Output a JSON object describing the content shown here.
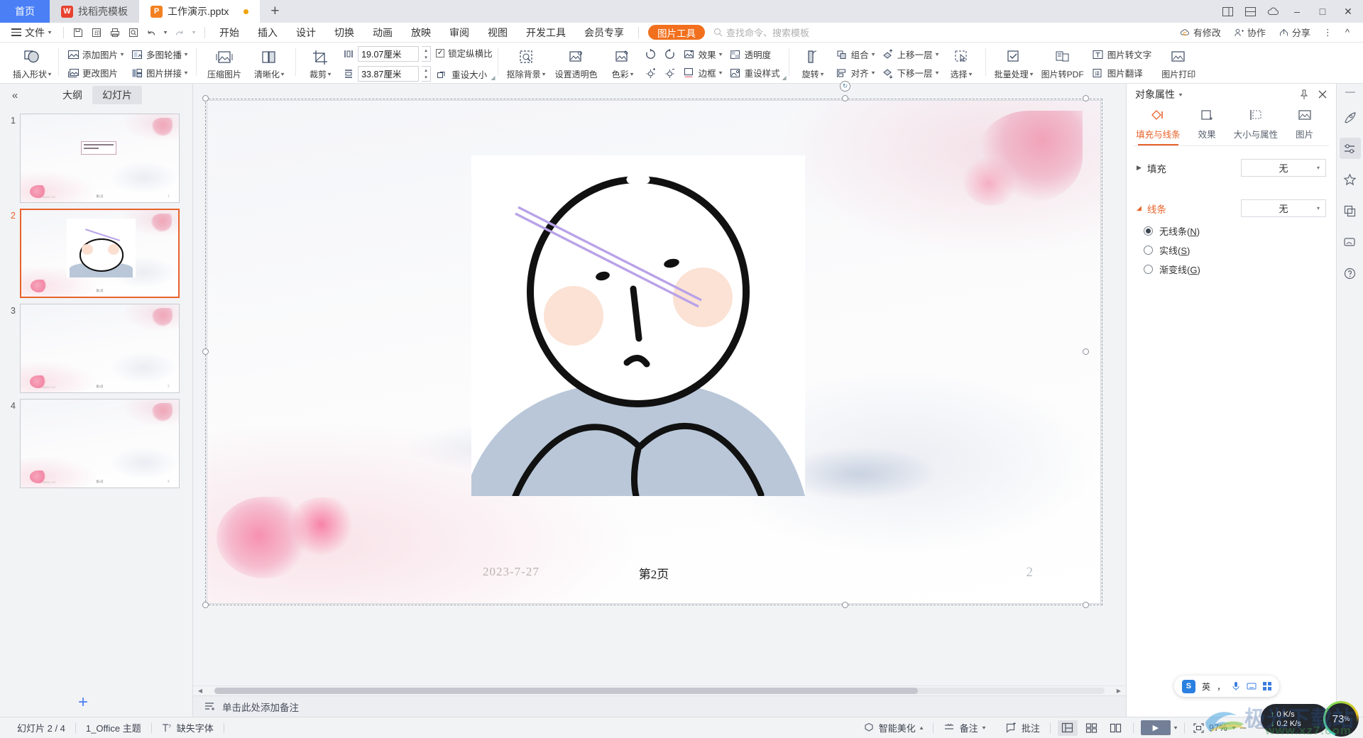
{
  "titlebar": {
    "home_tab": "首页",
    "tabs": [
      {
        "label": "找稻壳模板",
        "icon": "wps-template-icon",
        "active": false,
        "icon_color": "#e8422f",
        "icon_char": "W"
      },
      {
        "label": "工作演示.pptx",
        "icon": "presentation-icon",
        "active": true,
        "icon_color": "#f28121",
        "icon_char": "P"
      }
    ],
    "new_tab": "+",
    "right_icons": [
      "layout-icon",
      "split-icon",
      "cloud-icon"
    ],
    "window_buttons": [
      "–",
      "□",
      "✕"
    ]
  },
  "menubar": {
    "file": "文件",
    "quick_icons": [
      "save-icon",
      "print-preview-icon",
      "print-icon",
      "find-icon",
      "undo-icon",
      "redo-icon",
      "customize-icon"
    ],
    "items": [
      "开始",
      "插入",
      "设计",
      "切换",
      "动画",
      "放映",
      "审阅",
      "视图",
      "开发工具",
      "会员专享"
    ],
    "active_pill": "图片工具",
    "search_placeholder": "查找命令、搜索模板",
    "right": [
      {
        "label": "有修改",
        "icon": "cloud-sync-icon"
      },
      {
        "label": "协作",
        "icon": "collaborate-icon"
      },
      {
        "label": "分享",
        "icon": "share-icon"
      }
    ]
  },
  "ribbon": {
    "groups": [
      {
        "name": "shapes",
        "big": [
          {
            "label": "插入形状",
            "icon": "insert-shape-icon",
            "has_caret": true
          }
        ]
      },
      {
        "name": "pictures",
        "pairs": [
          [
            {
              "label": "添加图片",
              "icon": "add-picture-icon",
              "has_caret": true
            },
            {
              "label": "更改图片",
              "icon": "change-picture-icon",
              "has_caret": false
            }
          ],
          [
            {
              "label": "多图轮播",
              "icon": "carousel-icon",
              "has_caret": true
            },
            {
              "label": "图片拼接",
              "icon": "picture-splice-icon",
              "has_caret": true
            }
          ]
        ]
      },
      {
        "name": "compress",
        "big": [
          {
            "label": "压缩图片",
            "icon": "compress-picture-icon",
            "has_caret": false
          },
          {
            "label": "清晰化",
            "icon": "sharpen-icon",
            "has_caret": true
          }
        ]
      },
      {
        "name": "size",
        "big": [
          {
            "label": "裁剪",
            "icon": "crop-icon",
            "has_caret": true
          }
        ],
        "width_value": "19.07厘米",
        "height_value": "33.87厘米",
        "lock_ratio_label": "锁定纵横比",
        "lock_ratio_checked": true,
        "reset_size_label": "重设大小"
      },
      {
        "name": "adjust",
        "big": [
          {
            "label": "抠除背景",
            "icon": "remove-background-icon",
            "has_caret": true
          },
          {
            "label": "设置透明色",
            "icon": "set-transparent-color-icon",
            "has_caret": false
          },
          {
            "label": "色彩",
            "icon": "color-icon",
            "has_caret": true
          }
        ],
        "rotate_icons": [
          "rotate-right-icon",
          "rotate-left-icon",
          "brightness-up-icon",
          "brightness-down-icon"
        ],
        "pairs": [
          [
            {
              "label": "效果",
              "icon": "effects-icon",
              "has_caret": true
            },
            {
              "label": "边框",
              "icon": "border-icon",
              "has_caret": true
            }
          ],
          [
            {
              "label": "透明度",
              "icon": "transparency-icon",
              "has_caret": false
            },
            {
              "label": "重设样式",
              "icon": "reset-style-icon",
              "has_caret": false
            }
          ]
        ]
      },
      {
        "name": "arrange",
        "big": [
          {
            "label": "旋转",
            "icon": "rotate-icon",
            "has_caret": true
          }
        ],
        "pairs": [
          [
            {
              "label": "组合",
              "icon": "group-icon",
              "has_caret": true
            },
            {
              "label": "对齐",
              "icon": "align-icon",
              "has_caret": true
            }
          ],
          [
            {
              "label": "上移一层",
              "icon": "bring-forward-icon",
              "has_caret": true
            },
            {
              "label": "下移一层",
              "icon": "send-backward-icon",
              "has_caret": true
            }
          ]
        ],
        "select": {
          "label": "选择",
          "icon": "select-objects-icon",
          "has_caret": true
        }
      },
      {
        "name": "convert",
        "big": [
          {
            "label": "批量处理",
            "icon": "batch-process-icon",
            "has_caret": true
          },
          {
            "label": "图片转PDF",
            "icon": "picture-to-pdf-icon",
            "has_caret": false
          }
        ],
        "pairs": [
          [
            {
              "label": "图片转文字",
              "icon": "picture-to-text-icon",
              "has_caret": false
            }
          ],
          [
            {
              "label": "图片翻译",
              "icon": "picture-translate-icon",
              "has_caret": false
            }
          ]
        ],
        "print": {
          "label": "图片打印",
          "icon": "picture-print-icon",
          "has_caret": false
        }
      }
    ]
  },
  "slide_panel": {
    "collapse_icon": "collapse-left-icon",
    "tabs": [
      {
        "label": "大纲",
        "selected": false
      },
      {
        "label": "幻灯片",
        "selected": true
      }
    ],
    "slides": [
      {
        "number": "1",
        "active": false,
        "has_textbox": true
      },
      {
        "number": "2",
        "active": true,
        "has_picture": true
      },
      {
        "number": "3",
        "active": false
      },
      {
        "number": "4",
        "active": false
      }
    ],
    "add_slide_label": "+"
  },
  "canvas": {
    "slide_date": "2023-7-27",
    "slide_page_label": "第2页",
    "slide_number": "2",
    "selected_object": "picture-placeholder"
  },
  "notes": {
    "icon": "notes-icon",
    "placeholder": "单击此处添加备注"
  },
  "properties": {
    "title": "对象属性",
    "title_caret": "▾",
    "pin_icon": "pin-icon",
    "close_icon": "close-icon",
    "tabs": [
      {
        "label": "填充与线条",
        "icon": "fill-line-icon",
        "selected": true
      },
      {
        "label": "效果",
        "icon": "effects-panel-icon",
        "selected": false
      },
      {
        "label": "大小与属性",
        "icon": "size-properties-icon",
        "selected": false
      },
      {
        "label": "图片",
        "icon": "picture-panel-icon",
        "selected": false
      }
    ],
    "fill": {
      "label": "填充",
      "expanded": false,
      "value": "无"
    },
    "line": {
      "label": "线条",
      "expanded": true,
      "value": "无",
      "options": [
        {
          "label": "无线条",
          "accel": "N",
          "selected": true
        },
        {
          "label": "实线",
          "accel": "S",
          "selected": false
        },
        {
          "label": "渐变线",
          "accel": "G",
          "selected": false
        }
      ]
    }
  },
  "rail": {
    "items": [
      {
        "icon": "rocket-icon",
        "selected": false
      },
      {
        "icon": "properties-slider-icon",
        "selected": true
      },
      {
        "icon": "star-icon",
        "selected": false
      },
      {
        "icon": "layers-icon",
        "selected": false
      },
      {
        "icon": "resource-icon",
        "selected": false
      },
      {
        "icon": "help-circle-icon",
        "selected": false
      }
    ]
  },
  "status": {
    "slide_count": "幻灯片 2 / 4",
    "theme": "1_Office 主题",
    "missing_font": "缺失字体",
    "missing_font_icon": "font-warning-icon",
    "beautify": "智能美化",
    "notes_btn": "备注",
    "comment_btn": "批注",
    "view_buttons": [
      "normal-view-icon",
      "slide-sorter-icon",
      "reading-view-icon"
    ],
    "play_icon": "play-icon",
    "fit_icon": "fit-to-window-icon",
    "zoom": "97%",
    "zoom_minus": "–",
    "zoom_plus": "+"
  },
  "floating": {
    "ime": {
      "lang": "英",
      "icons": [
        "punctuation-icon",
        "mic-icon",
        "keyboard-icon",
        "apps-icon"
      ]
    },
    "network": {
      "up": "0 K/s",
      "down": "0.2 K/s",
      "up_icon": "arrow-up-icon",
      "down_icon": "arrow-down-icon"
    },
    "cpu": {
      "value": "73",
      "unit": "%"
    },
    "watermark": "极光下载站",
    "watermark2": "www.xz7.com"
  },
  "colors": {
    "accent": "#e8622a",
    "home_blue": "#4a7ff5",
    "pill_orange": "#f2701d",
    "panel_bg": "#f2f3f5"
  }
}
